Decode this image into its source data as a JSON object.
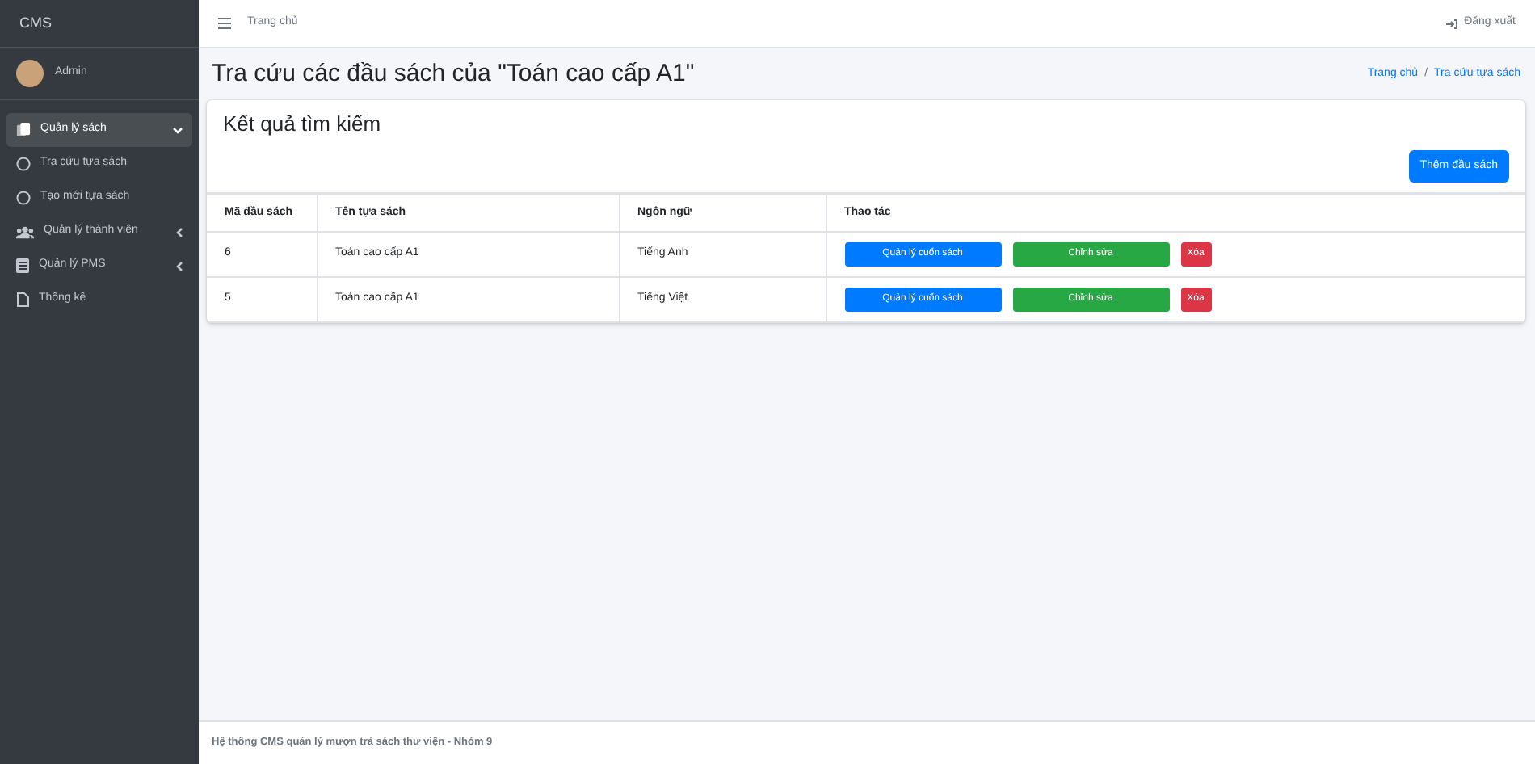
{
  "sidebar": {
    "brand": "CMS",
    "user": "Admin",
    "items": [
      {
        "label": "Quản lý sách",
        "selected": true,
        "expanded": true,
        "children": [
          {
            "label": "Tra cứu tựa sách",
            "selected": false
          },
          {
            "label": "Tạo mới tựa sách",
            "selected": false
          }
        ]
      },
      {
        "label": "Quản lý thành viên",
        "selected": false,
        "expanded": false
      },
      {
        "label": "Quản lý PMS",
        "selected": false,
        "expanded": false
      },
      {
        "label": "Thống kê",
        "selected": false
      }
    ]
  },
  "navbar": {
    "link": "Trang chủ",
    "logout": "Đăng xuất"
  },
  "page_header": {
    "title": "Tra cứu các đầu sách của \"Toán cao cấp A1\"",
    "breadcrumb": [
      "Trang chủ",
      "Tra cứu tựa sách"
    ],
    "breadcrumb_separator": "/"
  },
  "card": {
    "title": "Kết quả tìm kiếm",
    "add_button": "Thêm đầu sách",
    "table": {
      "columns": [
        "Mã đầu sách",
        "Tên tựa sách",
        "Ngôn ngữ",
        "Thao tác"
      ],
      "rows": [
        {
          "cells": [
            "6",
            "Toán cao cấp A1",
            "Tiếng Anh"
          ],
          "actions": [
            {
              "label": "Quản lý cuốn sách",
              "kind": "manage"
            },
            {
              "label": "Chỉnh sửa",
              "kind": "edit"
            },
            {
              "label": "Xóa",
              "kind": "delete"
            }
          ]
        },
        {
          "cells": [
            "5",
            "Toán cao cấp A1",
            "Tiếng Việt"
          ],
          "actions": [
            {
              "label": "Quản lý cuốn sách",
              "kind": "manage"
            },
            {
              "label": "Chỉnh sửa",
              "kind": "edit"
            },
            {
              "label": "Xóa",
              "kind": "delete"
            }
          ]
        }
      ]
    }
  },
  "footer": "Hệ thống CMS quản lý mượn trả sách thư viện - Nhóm 9"
}
